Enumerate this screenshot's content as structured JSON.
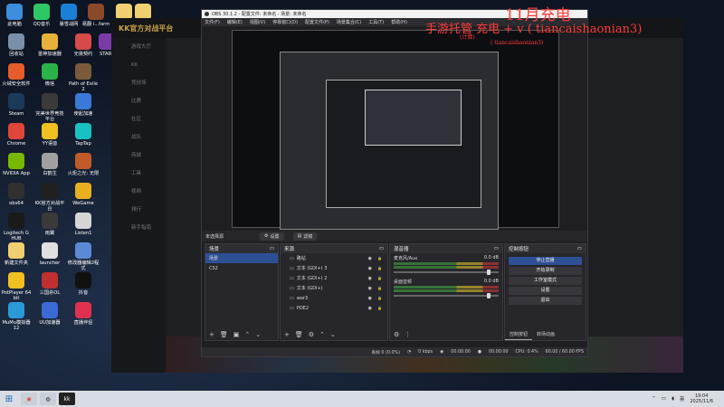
{
  "desktop": {
    "icons": [
      {
        "label": "此电脑",
        "color": "#3d8ddc"
      },
      {
        "label": "QQ音乐",
        "color": "#2ec766"
      },
      {
        "label": "暴雪战网",
        "color": "#1b7fd6"
      },
      {
        "label": "易翻 i...farm",
        "color": "#8a4a2a"
      },
      {
        "label": "",
        "color": "#f0d070"
      },
      {
        "label": "",
        "color": "#f0d070"
      },
      {
        "label": "回收站",
        "color": "#7a8fa8"
      },
      {
        "label": "雷神加速器",
        "color": "#e8b23a"
      },
      {
        "label": "无畏契约",
        "color": "#d64a4a"
      },
      {
        "label": "START",
        "color": "#7a3aa8"
      },
      {
        "label": "火绒安全软件",
        "color": "#e65c2a"
      },
      {
        "label": "微信",
        "color": "#2bb34a"
      },
      {
        "label": "Path of Exile 2",
        "color": "#7a5a3a"
      },
      {
        "label": "Steam",
        "color": "#1b3a5a"
      },
      {
        "label": "完美世界竞技平台",
        "color": "#3a3a3a"
      },
      {
        "label": "使起加速",
        "color": "#3a7ad6"
      },
      {
        "label": "Chrome",
        "color": "#e0453a"
      },
      {
        "label": "YY语音",
        "color": "#f0c020"
      },
      {
        "label": "TapTap",
        "color": "#19c2c2"
      },
      {
        "label": "NVIDIA App",
        "color": "#76b900"
      },
      {
        "label": "白鹤生",
        "color": "#a0a0a0"
      },
      {
        "label": "火炬之光: 无限",
        "color": "#c05a2a"
      },
      {
        "label": "obs64",
        "color": "#303030"
      },
      {
        "label": "KK官方对战平台",
        "color": "#202020"
      },
      {
        "label": "WeGame",
        "color": "#e8b020"
      },
      {
        "label": "Logitech G HUB",
        "color": "#1a1a1a"
      },
      {
        "label": "雨翼",
        "color": "#3a3a3a"
      },
      {
        "label": "Listen1",
        "color": "#d6d6d6"
      },
      {
        "label": "新建文件夹",
        "color": "#f0d070"
      },
      {
        "label": "launcher",
        "color": "#e0e0e0"
      },
      {
        "label": "修改器编辑2程式",
        "color": "#5a8ad6"
      },
      {
        "label": "PotPlayer 64 bit",
        "color": "#f0c020"
      },
      {
        "label": "三国杀OL",
        "color": "#c03030"
      },
      {
        "label": "抖音",
        "color": "#111111"
      },
      {
        "label": "MuMu模拟器12",
        "color": "#2a9ad6"
      },
      {
        "label": "UU加速器",
        "color": "#3a6ad6"
      },
      {
        "label": "直播伴侣",
        "color": "#e03050"
      }
    ]
  },
  "bgapp": {
    "brand": "KK官方对战平台",
    "nav": [
      "游戏大厅",
      "KK",
      "竞技场",
      "比赛",
      "社区",
      "战队",
      "商城",
      "工具",
      "视频",
      "排行",
      "新手指南"
    ]
  },
  "obs": {
    "title": "OBS 30.1.2 - 配置文件: 未命名 - 场景: 未命名",
    "menu": [
      "文件(F)",
      "编辑(E)",
      "视图(V)",
      "停靠窗口(D)",
      "配置文件(P)",
      "场景集合(C)",
      "工具(T)",
      "帮助(H)"
    ],
    "no_source": "未选择源",
    "props_btn": "设置",
    "filters_btn": "滤镜",
    "scenes": {
      "title": "场景",
      "items": [
        "场景",
        "CS2"
      ]
    },
    "sources": {
      "title": "来源",
      "items": [
        "路钻",
        "文本 (GDI+) 3",
        "文本 (GDI+) 2",
        "文本 (GDI+)",
        "war3",
        "POE2"
      ]
    },
    "mixer": {
      "title": "混音器",
      "channels": [
        {
          "name": "麦克风/Aux",
          "db": "0.0 dB",
          "level": 0.92
        },
        {
          "name": "桌面音频",
          "db": "0.0 dB",
          "level": 0.92
        }
      ]
    },
    "controls": {
      "title": "控制按钮",
      "buttons": [
        "停止直播",
        "开始录制",
        "工作室模式",
        "设置",
        "退出"
      ],
      "tabs": [
        "控制按钮",
        "转场动画"
      ]
    },
    "status": {
      "dropped": "丢帧 0 (0.0%)",
      "bitrate": "0 kbps",
      "stream_time": "00:00:00",
      "rec_time": "00:00:00",
      "cpu": "CPU: 0.4%",
      "fps": "60.00 / 60.00 FPS"
    }
  },
  "overlay": {
    "line1": "11月充电",
    "line2": "手游托管 充电 + v ( tiancaishaonian3)",
    "small1": "(计算)",
    "small2": "( tiancaishaonian3)"
  },
  "taskbar": {
    "lang": "英",
    "time": "19:04",
    "date": "2025/11/6"
  }
}
